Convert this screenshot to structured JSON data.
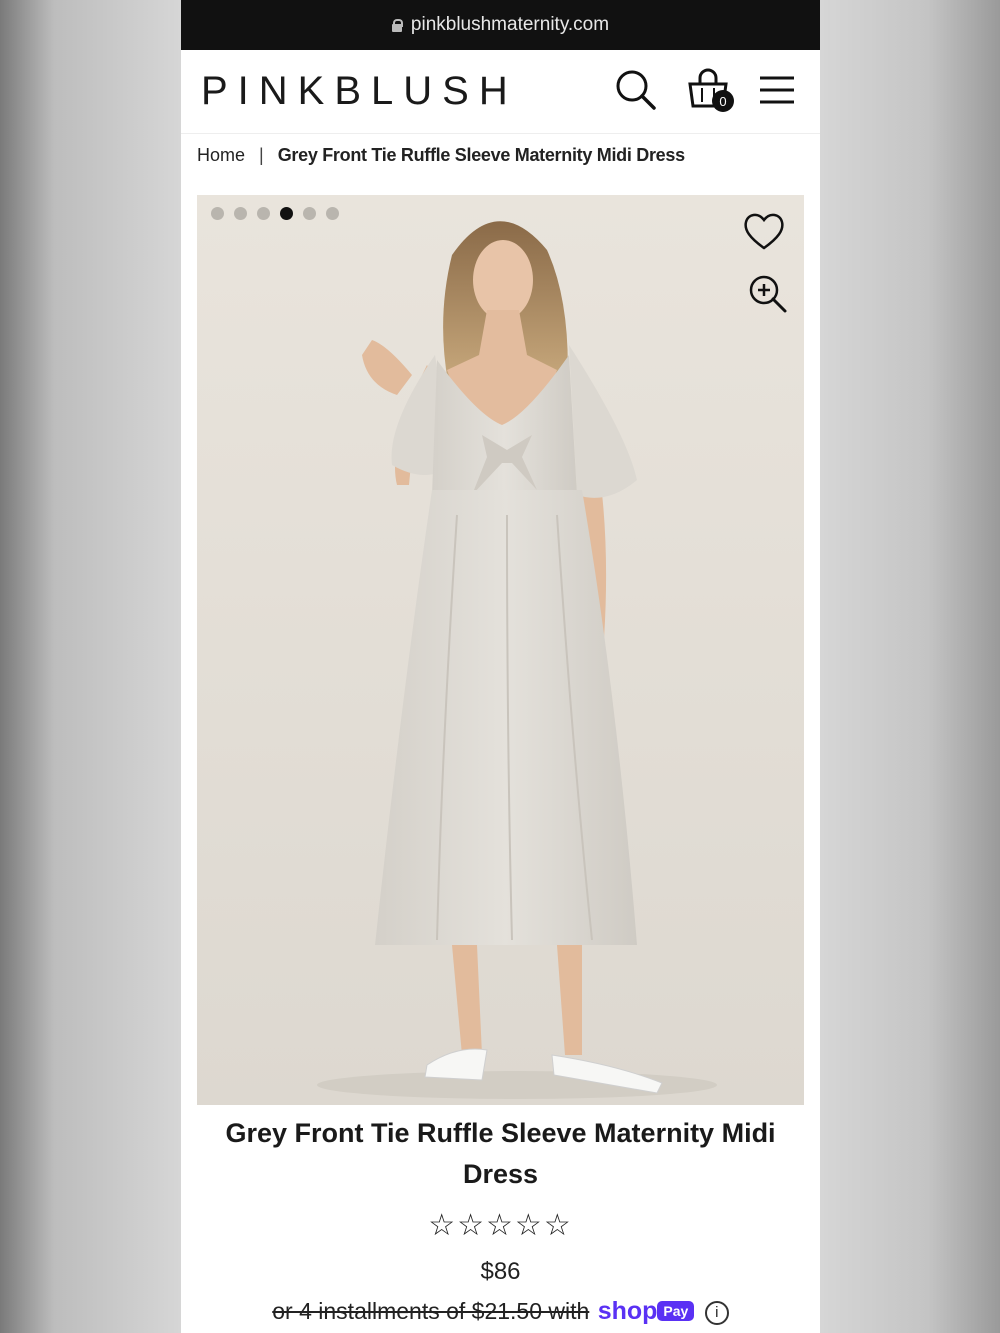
{
  "browser": {
    "url": "pinkblushmaternity.com"
  },
  "header": {
    "logo": "PINKBLUSH",
    "cart_count": "0"
  },
  "breadcrumb": {
    "home": "Home",
    "separator": "|",
    "current": "Grey Front Tie Ruffle Sleeve Maternity Midi Dress"
  },
  "gallery": {
    "image_count": 6,
    "active_index": 3
  },
  "product": {
    "title": "Grey Front Tie Ruffle Sleeve Maternity Midi Dress",
    "rating_stars": "☆☆☆☆☆",
    "price": "$86",
    "installments_prefix": "or 4 installments of $21.50 with",
    "shop_label": "shop",
    "pay_label": "Pay",
    "info_label": "i"
  },
  "colors": {
    "shop_pay": "#5a31f4",
    "gallery_bg": "#e7e2da"
  }
}
